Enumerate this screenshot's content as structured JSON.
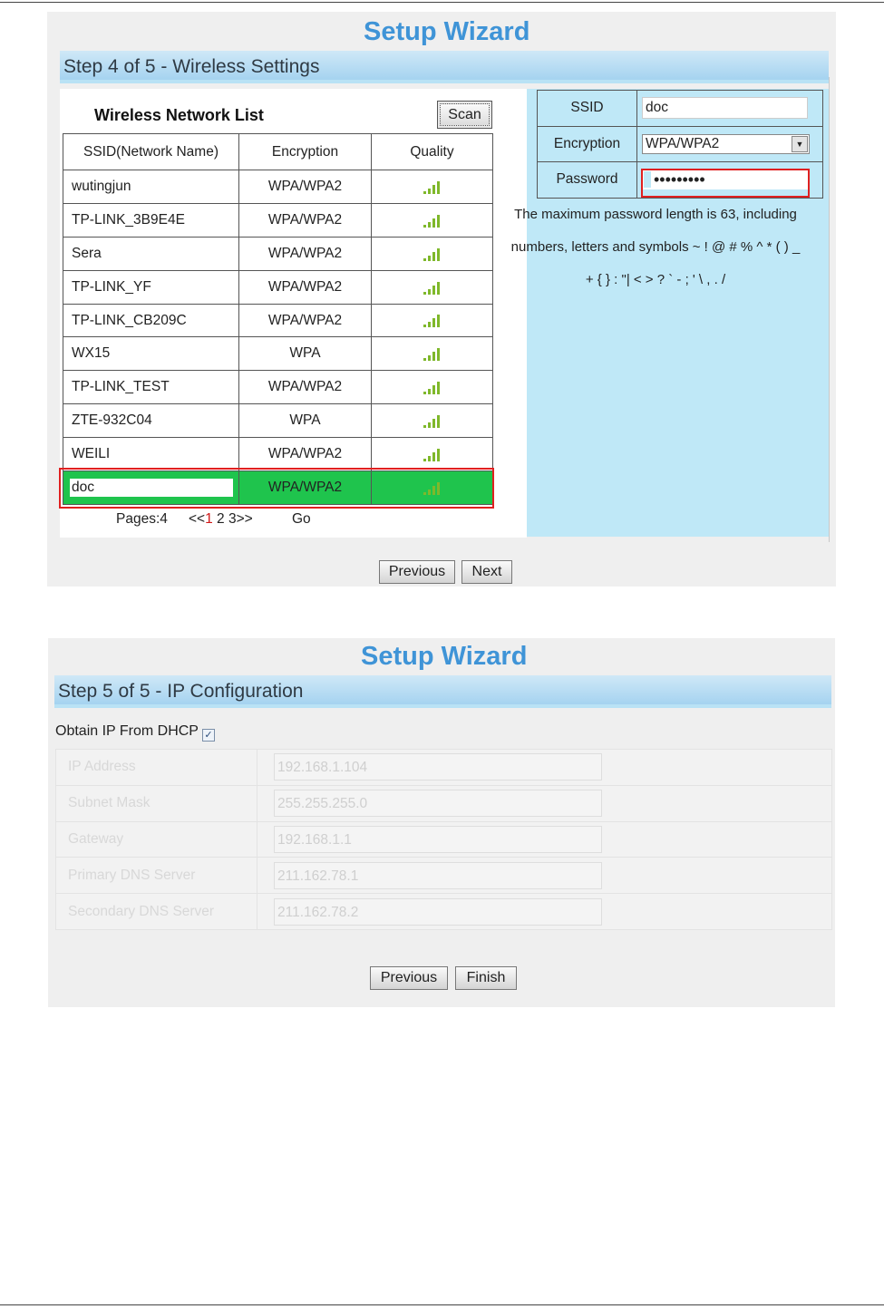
{
  "wizard1": {
    "title": "Setup Wizard",
    "step": "Step 4 of 5 - Wireless Settings",
    "list_title": "Wireless Network List",
    "scan_label": "Scan",
    "columns": [
      "SSID(Network Name)",
      "Encryption",
      "Quality"
    ],
    "networks": [
      {
        "ssid": "wutingjun",
        "encryption": "WPA/WPA2"
      },
      {
        "ssid": "TP-LINK_3B9E4E",
        "encryption": "WPA/WPA2"
      },
      {
        "ssid": "Sera",
        "encryption": "WPA/WPA2"
      },
      {
        "ssid": "TP-LINK_YF",
        "encryption": "WPA/WPA2"
      },
      {
        "ssid": "TP-LINK_CB209C",
        "encryption": "WPA/WPA2"
      },
      {
        "ssid": "WX15",
        "encryption": "WPA"
      },
      {
        "ssid": "TP-LINK_TEST",
        "encryption": "WPA/WPA2"
      },
      {
        "ssid": "ZTE-932C04",
        "encryption": "WPA"
      },
      {
        "ssid": "WEILI",
        "encryption": "WPA/WPA2"
      },
      {
        "ssid": "doc",
        "encryption": "WPA/WPA2"
      }
    ],
    "signal_icon": "signal-bars-icon",
    "pager": {
      "label": "Pages:4",
      "prefix": "<<",
      "current": "1",
      "rest": " 2 3>>",
      "go_label": "Go"
    },
    "form": {
      "ssid_label": "SSID",
      "ssid_value": "doc",
      "encryption_label": "Encryption",
      "encryption_value": "WPA/WPA2",
      "password_label": "Password",
      "password_mask": "•••••••••"
    },
    "hint_lines": [
      "The maximum password length is 63, including",
      "numbers, letters and symbols ~ ! @ # % ^ * ( ) _",
      "+ { } : \"| < > ? ` - ; ' \\ , . /"
    ],
    "previous_label": "Previous",
    "next_label": "Next",
    "colors": {
      "accent": "#3f94d7",
      "selected_row": "#1fc44d",
      "highlight": "#e02020",
      "panel": "#bfe8f7"
    }
  },
  "wizard2": {
    "title": "Setup Wizard",
    "step": "Step 5 of 5 - IP Configuration",
    "dhcp_label": "Obtain IP From DHCP",
    "dhcp_checked": true,
    "fields": [
      {
        "label": "IP Address",
        "value": "192.168.1.104"
      },
      {
        "label": "Subnet Mask",
        "value": "255.255.255.0"
      },
      {
        "label": "Gateway",
        "value": "192.168.1.1"
      },
      {
        "label": "Primary DNS Server",
        "value": "211.162.78.1"
      },
      {
        "label": "Secondary DNS Server",
        "value": "211.162.78.2"
      }
    ],
    "previous_label": "Previous",
    "finish_label": "Finish"
  }
}
